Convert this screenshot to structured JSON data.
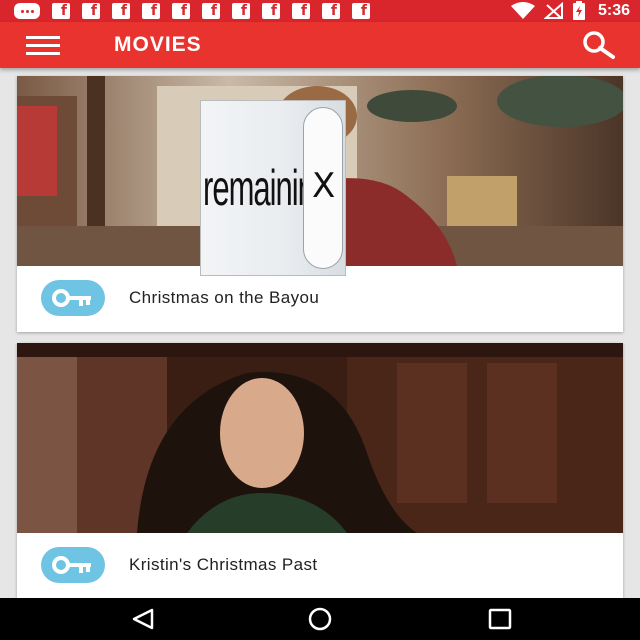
{
  "status_bar": {
    "time": "5:36",
    "notification_icons": [
      "message-icon",
      "facebook-icon",
      "facebook-icon",
      "facebook-icon",
      "facebook-icon",
      "facebook-icon",
      "facebook-icon",
      "facebook-icon",
      "facebook-icon",
      "facebook-icon",
      "facebook-icon",
      "facebook-icon"
    ],
    "facebook_glyph": "f",
    "system_icons": [
      "wifi-icon",
      "no-signal-icon",
      "battery-charging-icon"
    ]
  },
  "app_bar": {
    "title": "MOVIES",
    "menu_icon": "hamburger-menu-icon",
    "search_icon": "search-icon",
    "color": "#e8332f"
  },
  "movies": [
    {
      "title": "Christmas on the Bayou",
      "badge_icon": "key-icon"
    },
    {
      "title": "Kristin's Christmas Past",
      "badge_icon": "key-icon"
    }
  ],
  "overlay_ad": {
    "text": "remaining",
    "close_label": "X"
  },
  "nav_bar": {
    "buttons": [
      "back-triangle-icon",
      "home-circle-icon",
      "recents-square-icon"
    ]
  },
  "colors": {
    "status_bar": "#d9262c",
    "app_bar": "#e8332f",
    "key_badge": "#6fc3e3",
    "background": "#e6e6e6"
  }
}
